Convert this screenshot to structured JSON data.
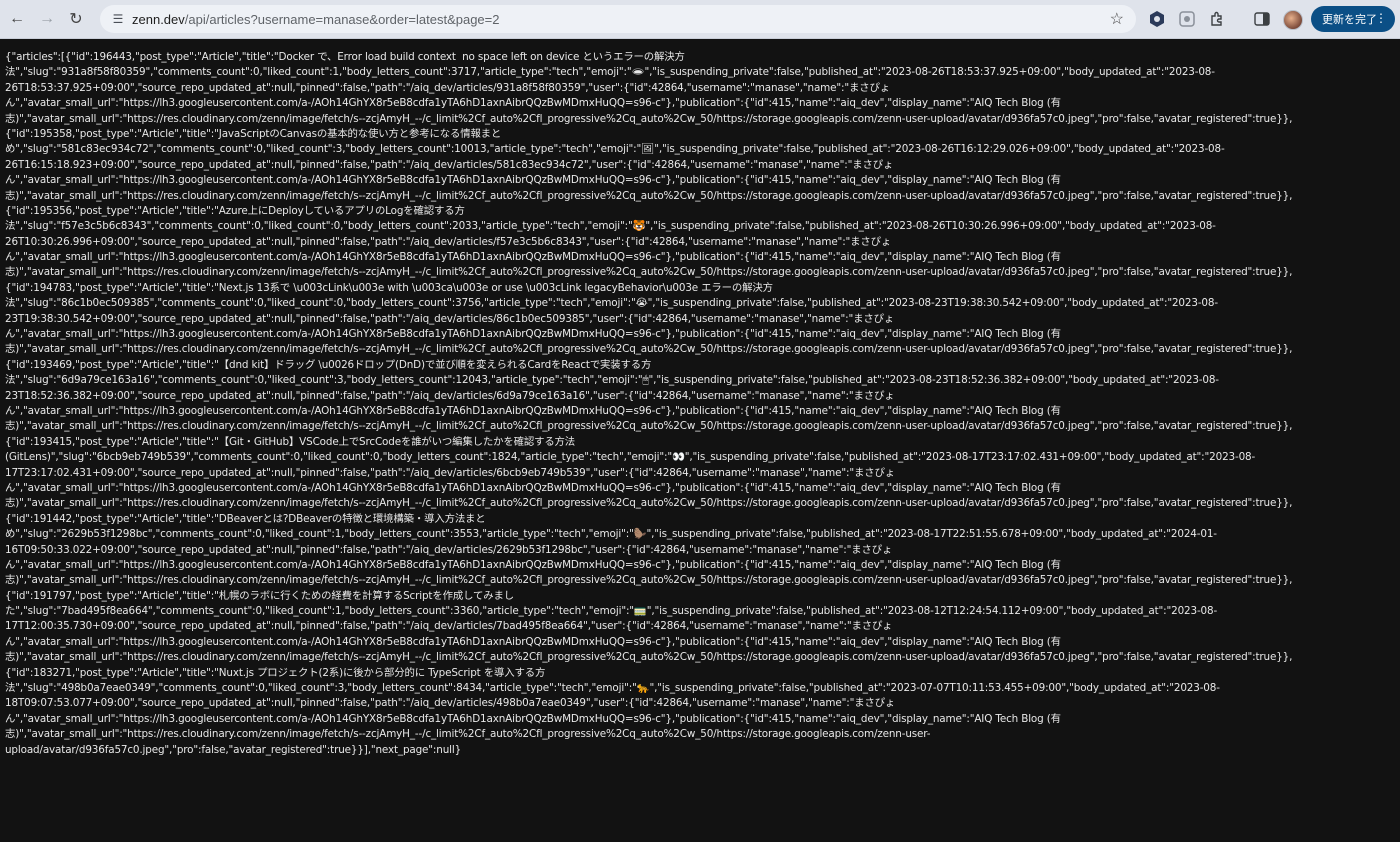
{
  "browser": {
    "url_host": "zenn.dev",
    "url_path": "/api/articles?username=manase&order=latest&page=2",
    "update_button_label": "更新を完了",
    "icons": [
      "back-icon",
      "forward-icon",
      "reload-icon",
      "site-settings-icon",
      "bookmark-star-icon",
      "extension-icon",
      "puzzle-icon",
      "side-panel-icon",
      "profile-avatar",
      "more-icon"
    ]
  },
  "json_lines": [
    "{\"articles\":[{\"id\":196443,\"post_type\":\"Article\",\"title\":\"Docker で、Error load build context  no space left on device というエラーの解決方",
    "法\",\"slug\":\"931a8f58f80359\",\"comments_count\":0,\"liked_count\":1,\"body_letters_count\":3717,\"article_type\":\"tech\",\"emoji\":\"🕳\",\"is_suspending_private\":false,\"published_at\":\"2023-08-26T18:53:37.925+09:00\",\"body_updated_at\":\"2023-08-",
    "26T18:53:37.925+09:00\",\"source_repo_updated_at\":null,\"pinned\":false,\"path\":\"/aiq_dev/articles/931a8f58f80359\",\"user\":{\"id\":42864,\"username\":\"manase\",\"name\":\"まさぴょ",
    "ん\",\"avatar_small_url\":\"https://lh3.googleusercontent.com/a-/AOh14GhYX8r5eB8cdfa1yTA6hD1axnAibrQQzBwMDmxHuQQ=s96-c\"},\"publication\":{\"id\":415,\"name\":\"aiq_dev\",\"display_name\":\"AIQ Tech Blog (有",
    "志)\",\"avatar_small_url\":\"https://res.cloudinary.com/zenn/image/fetch/s--zcjAmyH_--/c_limit%2Cf_auto%2Cfl_progressive%2Cq_auto%2Cw_50/https://storage.googleapis.com/zenn-user-upload/avatar/d936fa57c0.jpeg\",\"pro\":false,\"avatar_registered\":true}},",
    "{\"id\":195358,\"post_type\":\"Article\",\"title\":\"JavaScriptのCanvasの基本的な使い方と参考になる情報まと",
    "め\",\"slug\":\"581c83ec934c72\",\"comments_count\":0,\"liked_count\":3,\"body_letters_count\":10013,\"article_type\":\"tech\",\"emoji\":\"🖼\",\"is_suspending_private\":false,\"published_at\":\"2023-08-26T16:12:29.026+09:00\",\"body_updated_at\":\"2023-08-",
    "26T16:15:18.923+09:00\",\"source_repo_updated_at\":null,\"pinned\":false,\"path\":\"/aiq_dev/articles/581c83ec934c72\",\"user\":{\"id\":42864,\"username\":\"manase\",\"name\":\"まさぴょ",
    "ん\",\"avatar_small_url\":\"https://lh3.googleusercontent.com/a-/AOh14GhYX8r5eB8cdfa1yTA6hD1axnAibrQQzBwMDmxHuQQ=s96-c\"},\"publication\":{\"id\":415,\"name\":\"aiq_dev\",\"display_name\":\"AIQ Tech Blog (有",
    "志)\",\"avatar_small_url\":\"https://res.cloudinary.com/zenn/image/fetch/s--zcjAmyH_--/c_limit%2Cf_auto%2Cfl_progressive%2Cq_auto%2Cw_50/https://storage.googleapis.com/zenn-user-upload/avatar/d936fa57c0.jpeg\",\"pro\":false,\"avatar_registered\":true}},",
    "{\"id\":195356,\"post_type\":\"Article\",\"title\":\"Azure上にDeployしているアプリのLogを確認する方",
    "法\",\"slug\":\"f57e3c5b6c8343\",\"comments_count\":0,\"liked_count\":0,\"body_letters_count\":2033,\"article_type\":\"tech\",\"emoji\":\"🐯\",\"is_suspending_private\":false,\"published_at\":\"2023-08-26T10:30:26.996+09:00\",\"body_updated_at\":\"2023-08-",
    "26T10:30:26.996+09:00\",\"source_repo_updated_at\":null,\"pinned\":false,\"path\":\"/aiq_dev/articles/f57e3c5b6c8343\",\"user\":{\"id\":42864,\"username\":\"manase\",\"name\":\"まさぴょ",
    "ん\",\"avatar_small_url\":\"https://lh3.googleusercontent.com/a-/AOh14GhYX8r5eB8cdfa1yTA6hD1axnAibrQQzBwMDmxHuQQ=s96-c\"},\"publication\":{\"id\":415,\"name\":\"aiq_dev\",\"display_name\":\"AIQ Tech Blog (有",
    "志)\",\"avatar_small_url\":\"https://res.cloudinary.com/zenn/image/fetch/s--zcjAmyH_--/c_limit%2Cf_auto%2Cfl_progressive%2Cq_auto%2Cw_50/https://storage.googleapis.com/zenn-user-upload/avatar/d936fa57c0.jpeg\",\"pro\":false,\"avatar_registered\":true}},",
    "{\"id\":194783,\"post_type\":\"Article\",\"title\":\"Next.js 13系で \\u003cLink\\u003e with \\u003ca\\u003e or use \\u003cLink legacyBehavior\\u003e エラーの解決方",
    "法\",\"slug\":\"86c1b0ec509385\",\"comments_count\":0,\"liked_count\":0,\"body_letters_count\":3756,\"article_type\":\"tech\",\"emoji\":\"😭\",\"is_suspending_private\":false,\"published_at\":\"2023-08-23T19:38:30.542+09:00\",\"body_updated_at\":\"2023-08-",
    "23T19:38:30.542+09:00\",\"source_repo_updated_at\":null,\"pinned\":false,\"path\":\"/aiq_dev/articles/86c1b0ec509385\",\"user\":{\"id\":42864,\"username\":\"manase\",\"name\":\"まさぴょ",
    "ん\",\"avatar_small_url\":\"https://lh3.googleusercontent.com/a-/AOh14GhYX8r5eB8cdfa1yTA6hD1axnAibrQQzBwMDmxHuQQ=s96-c\"},\"publication\":{\"id\":415,\"name\":\"aiq_dev\",\"display_name\":\"AIQ Tech Blog (有",
    "志)\",\"avatar_small_url\":\"https://res.cloudinary.com/zenn/image/fetch/s--zcjAmyH_--/c_limit%2Cf_auto%2Cfl_progressive%2Cq_auto%2Cw_50/https://storage.googleapis.com/zenn-user-upload/avatar/d936fa57c0.jpeg\",\"pro\":false,\"avatar_registered\":true}},",
    "{\"id\":193469,\"post_type\":\"Article\",\"title\":\"【dnd kit】ドラッグ \\u0026ドロップ(DnD)で並び順を変えられるCardをReactで実装する方",
    "法\",\"slug\":\"6d9a79ce163a16\",\"comments_count\":0,\"liked_count\":3,\"body_letters_count\":12043,\"article_type\":\"tech\",\"emoji\":\"🖱\",\"is_suspending_private\":false,\"published_at\":\"2023-08-23T18:52:36.382+09:00\",\"body_updated_at\":\"2023-08-",
    "23T18:52:36.382+09:00\",\"source_repo_updated_at\":null,\"pinned\":false,\"path\":\"/aiq_dev/articles/6d9a79ce163a16\",\"user\":{\"id\":42864,\"username\":\"manase\",\"name\":\"まさぴょ",
    "ん\",\"avatar_small_url\":\"https://lh3.googleusercontent.com/a-/AOh14GhYX8r5eB8cdfa1yTA6hD1axnAibrQQzBwMDmxHuQQ=s96-c\"},\"publication\":{\"id\":415,\"name\":\"aiq_dev\",\"display_name\":\"AIQ Tech Blog (有",
    "志)\",\"avatar_small_url\":\"https://res.cloudinary.com/zenn/image/fetch/s--zcjAmyH_--/c_limit%2Cf_auto%2Cfl_progressive%2Cq_auto%2Cw_50/https://storage.googleapis.com/zenn-user-upload/avatar/d936fa57c0.jpeg\",\"pro\":false,\"avatar_registered\":true}},",
    "{\"id\":193415,\"post_type\":\"Article\",\"title\":\"【Git・GitHub】VSCode上でSrcCodeを誰がいつ編集したかを確認する方法",
    "(GitLens)\",\"slug\":\"6bcb9eb749b539\",\"comments_count\":0,\"liked_count\":0,\"body_letters_count\":1824,\"article_type\":\"tech\",\"emoji\":\"👀\",\"is_suspending_private\":false,\"published_at\":\"2023-08-17T23:17:02.431+09:00\",\"body_updated_at\":\"2023-08-",
    "17T23:17:02.431+09:00\",\"source_repo_updated_at\":null,\"pinned\":false,\"path\":\"/aiq_dev/articles/6bcb9eb749b539\",\"user\":{\"id\":42864,\"username\":\"manase\",\"name\":\"まさぴょ",
    "ん\",\"avatar_small_url\":\"https://lh3.googleusercontent.com/a-/AOh14GhYX8r5eB8cdfa1yTA6hD1axnAibrQQzBwMDmxHuQQ=s96-c\"},\"publication\":{\"id\":415,\"name\":\"aiq_dev\",\"display_name\":\"AIQ Tech Blog (有",
    "志)\",\"avatar_small_url\":\"https://res.cloudinary.com/zenn/image/fetch/s--zcjAmyH_--/c_limit%2Cf_auto%2Cfl_progressive%2Cq_auto%2Cw_50/https://storage.googleapis.com/zenn-user-upload/avatar/d936fa57c0.jpeg\",\"pro\":false,\"avatar_registered\":true}},",
    "{\"id\":191442,\"post_type\":\"Article\",\"title\":\"DBeaverとは?DBeaverの特徴と環境構築・導入方法まと",
    "め\",\"slug\":\"2629b53f1298bc\",\"comments_count\":0,\"liked_count\":1,\"body_letters_count\":3553,\"article_type\":\"tech\",\"emoji\":\"🦫\",\"is_suspending_private\":false,\"published_at\":\"2023-08-17T22:51:55.678+09:00\",\"body_updated_at\":\"2024-01-",
    "16T09:50:33.022+09:00\",\"source_repo_updated_at\":null,\"pinned\":false,\"path\":\"/aiq_dev/articles/2629b53f1298bc\",\"user\":{\"id\":42864,\"username\":\"manase\",\"name\":\"まさぴょ",
    "ん\",\"avatar_small_url\":\"https://lh3.googleusercontent.com/a-/AOh14GhYX8r5eB8cdfa1yTA6hD1axnAibrQQzBwMDmxHuQQ=s96-c\"},\"publication\":{\"id\":415,\"name\":\"aiq_dev\",\"display_name\":\"AIQ Tech Blog (有",
    "志)\",\"avatar_small_url\":\"https://res.cloudinary.com/zenn/image/fetch/s--zcjAmyH_--/c_limit%2Cf_auto%2Cfl_progressive%2Cq_auto%2Cw_50/https://storage.googleapis.com/zenn-user-upload/avatar/d936fa57c0.jpeg\",\"pro\":false,\"avatar_registered\":true}},",
    "{\"id\":191797,\"post_type\":\"Article\",\"title\":\"札幌のラボに行くための経費を計算するScriptを作成してみまし",
    "た\",\"slug\":\"7bad495f8ea664\",\"comments_count\":0,\"liked_count\":1,\"body_letters_count\":3360,\"article_type\":\"tech\",\"emoji\":\"🚃\",\"is_suspending_private\":false,\"published_at\":\"2023-08-12T12:24:54.112+09:00\",\"body_updated_at\":\"2023-08-",
    "17T12:00:35.730+09:00\",\"source_repo_updated_at\":null,\"pinned\":false,\"path\":\"/aiq_dev/articles/7bad495f8ea664\",\"user\":{\"id\":42864,\"username\":\"manase\",\"name\":\"まさぴょ",
    "ん\",\"avatar_small_url\":\"https://lh3.googleusercontent.com/a-/AOh14GhYX8r5eB8cdfa1yTA6hD1axnAibrQQzBwMDmxHuQQ=s96-c\"},\"publication\":{\"id\":415,\"name\":\"aiq_dev\",\"display_name\":\"AIQ Tech Blog (有",
    "志)\",\"avatar_small_url\":\"https://res.cloudinary.com/zenn/image/fetch/s--zcjAmyH_--/c_limit%2Cf_auto%2Cfl_progressive%2Cq_auto%2Cw_50/https://storage.googleapis.com/zenn-user-upload/avatar/d936fa57c0.jpeg\",\"pro\":false,\"avatar_registered\":true}},",
    "{\"id\":183271,\"post_type\":\"Article\",\"title\":\"Nuxt.js プロジェクト(2系)に後から部分的に TypeScript を導入する方",
    "法\",\"slug\":\"498b0a7eae0349\",\"comments_count\":0,\"liked_count\":3,\"body_letters_count\":8434,\"article_type\":\"tech\",\"emoji\":\"🐆\",\"is_suspending_private\":false,\"published_at\":\"2023-07-07T10:11:53.455+09:00\",\"body_updated_at\":\"2023-08-",
    "18T09:07:53.077+09:00\",\"source_repo_updated_at\":null,\"pinned\":false,\"path\":\"/aiq_dev/articles/498b0a7eae0349\",\"user\":{\"id\":42864,\"username\":\"manase\",\"name\":\"まさぴょ",
    "ん\",\"avatar_small_url\":\"https://lh3.googleusercontent.com/a-/AOh14GhYX8r5eB8cdfa1yTA6hD1axnAibrQQzBwMDmxHuQQ=s96-c\"},\"publication\":{\"id\":415,\"name\":\"aiq_dev\",\"display_name\":\"AIQ Tech Blog (有",
    "志)\",\"avatar_small_url\":\"https://res.cloudinary.com/zenn/image/fetch/s--zcjAmyH_--/c_limit%2Cf_auto%2Cfl_progressive%2Cq_auto%2Cw_50/https://storage.googleapis.com/zenn-user-",
    "upload/avatar/d936fa57c0.jpeg\",\"pro\":false,\"avatar_registered\":true}}],\"next_page\":null}"
  ]
}
